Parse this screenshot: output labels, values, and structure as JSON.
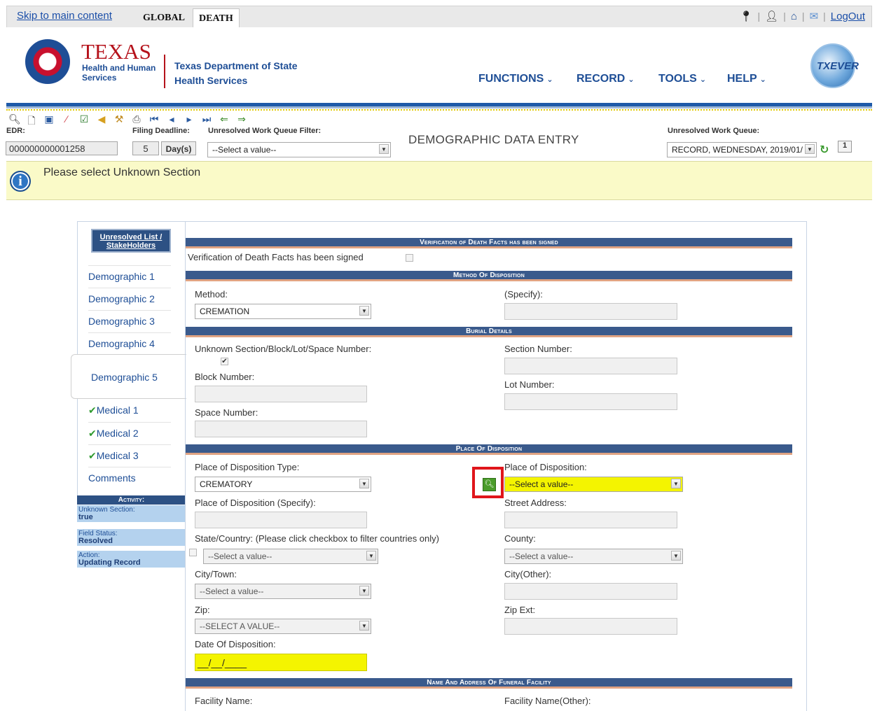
{
  "topbar": {
    "skip_link": "Skip to main content",
    "tabs": [
      {
        "label": "GLOBAL"
      },
      {
        "label": "DEATH"
      }
    ],
    "util_icons": [
      "map-marker-icon",
      "user-icon",
      "home-icon",
      "mail-icon"
    ],
    "separator": "|",
    "logout": "LogOut"
  },
  "header": {
    "logo_texas": "TEXAS",
    "logo_hhs_line1": "Health and Human",
    "logo_hhs_line2": "Services",
    "dshs_line1": "Texas Department of State",
    "dshs_line2": "Health Services",
    "nav": [
      "FUNCTIONS",
      "RECORD",
      "TOOLS",
      "HELP"
    ],
    "txever_logo": "TXEVER"
  },
  "toolbar": {
    "icons": [
      "binoculars-icon",
      "new-document-icon",
      "save-icon",
      "eraser-icon",
      "validate-icon",
      "edit-icon",
      "wrench-icon",
      "print-icon",
      "first-record-icon",
      "prev-record-icon",
      "next-record-icon",
      "last-record-icon",
      "back-arrow-icon",
      "forward-arrow-icon"
    ],
    "edr_label": "EDR:",
    "edr_value": "000000000001258",
    "filing_deadline_label": "Filing Deadline:",
    "filing_deadline_value": "5",
    "filing_deadline_unit": "Day(s)",
    "uwq_filter_label": "Unresolved Work Queue Filter:",
    "uwq_filter_value": "--Select a value--",
    "page_title": "DEMOGRAPHIC DATA ENTRY",
    "uwq_label": "Unresolved Work Queue:",
    "uwq_value": "RECORD, WEDNESDAY, 2019/01/",
    "uwq_count": "1"
  },
  "banner": {
    "message": "Please select Unknown Section"
  },
  "leftnav": {
    "unresolved_button": "Unresolved List / StakeHolders",
    "items": [
      {
        "label": "Demographic 1"
      },
      {
        "label": "Demographic 2"
      },
      {
        "label": "Demographic 3"
      },
      {
        "label": "Demographic 4"
      },
      {
        "label": "Demographic 5"
      },
      {
        "label": "Medical 1"
      },
      {
        "label": "Medical 2"
      },
      {
        "label": "Medical 3"
      },
      {
        "label": "Comments"
      }
    ],
    "activity_title": "Activity:",
    "activity": [
      {
        "label": "Unknown Section:",
        "value": "true"
      },
      {
        "label": "Field Status:",
        "value": "Resolved"
      },
      {
        "label": "Action:",
        "value": "Updating Record"
      }
    ]
  },
  "form": {
    "sections": {
      "verification": "Verification of Death Facts has been signed",
      "method": "Method Of Disposition",
      "burial": "Burial Details",
      "place": "Place Of Disposition",
      "funeral": "Name And Address Of Funeral Facility"
    },
    "verification_label": "Verification of Death Facts has been signed",
    "method_label": "Method:",
    "method_value": "CREMATION",
    "method_specify_label": "(Specify):",
    "unknown_section_label": "Unknown Section/Block/Lot/Space Number:",
    "unknown_section_checked": true,
    "section_number_label": "Section Number:",
    "block_number_label": "Block Number:",
    "lot_number_label": "Lot Number:",
    "space_number_label": "Space Number:",
    "pod_type_label": "Place of Disposition Type:",
    "pod_type_value": "CREMATORY",
    "pod_label": "Place of Disposition:",
    "pod_value": "--Select a value--",
    "pod_specify_label": "Place of Disposition (Specify):",
    "street_label": "Street Address:",
    "state_label": "State/Country: (Please click checkbox to filter countries only)",
    "state_value": "--Select a value--",
    "county_label": "County:",
    "county_value": "--Select a value--",
    "city_label": "City/Town:",
    "city_value": "--Select a value--",
    "city_other_label": "City(Other):",
    "zip_label": "Zip:",
    "zip_value": "--SELECT A VALUE--",
    "zip_ext_label": "Zip Ext:",
    "date_label": "Date Of Disposition:",
    "date_value": "__/__/____",
    "facility_name_label": "Facility Name:",
    "facility_name_other_label": "Facility Name(Other):"
  },
  "colors": {
    "brand_blue": "#1e4e96",
    "section_bar": "#3a5a8c",
    "required_yellow": "#f4f400",
    "banner_bg": "#fafac8",
    "highlight_red": "#e0161b"
  }
}
